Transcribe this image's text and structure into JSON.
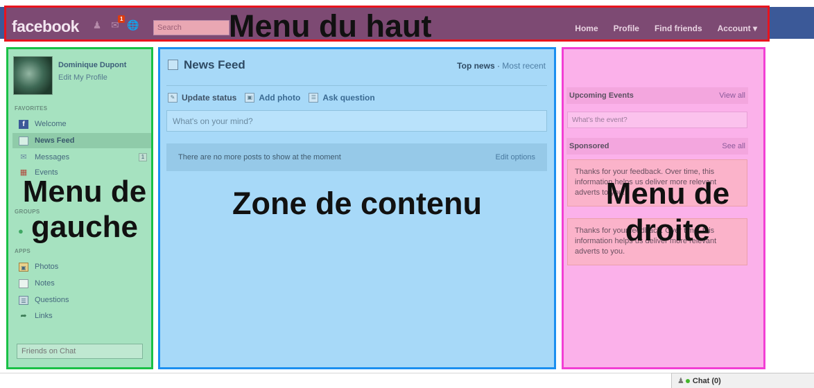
{
  "topbar": {
    "logo": "facebook",
    "notification_count": "1",
    "search_placeholder": "Search",
    "nav": [
      "Home",
      "Profile",
      "Find friends",
      "Account ▾"
    ],
    "overlay_label": "Menu du haut"
  },
  "left": {
    "profile_name": "Dominique Dupont",
    "edit_profile": "Edit My Profile",
    "favorites_header": "FAVORITES",
    "favorites": [
      {
        "label": "Welcome",
        "icon": "facebook-icon"
      },
      {
        "label": "News Feed",
        "icon": "news-feed-icon"
      },
      {
        "label": "Messages",
        "icon": "messages-icon",
        "count": "1"
      },
      {
        "label": "Events",
        "icon": "events-icon"
      }
    ],
    "groups_header": "GROUPS",
    "apps_header": "APPS",
    "apps": [
      {
        "label": "Photos",
        "icon": "photos-icon"
      },
      {
        "label": "Notes",
        "icon": "notes-icon"
      },
      {
        "label": "Questions",
        "icon": "questions-icon"
      },
      {
        "label": "Links",
        "icon": "links-icon"
      }
    ],
    "chat_search_placeholder": "Friends on Chat",
    "overlay_label": "Menu de gauche"
  },
  "center": {
    "title": "News Feed",
    "filter_top": "Top news",
    "filter_sep": " · ",
    "filter_recent": "Most recent",
    "tabs": [
      "Update status",
      "Add photo",
      "Ask question"
    ],
    "composer_placeholder": "What's on your mind?",
    "no_posts": "There are no more posts to show at the moment",
    "edit_options": "Edit options",
    "overlay_label": "Zone de contenu"
  },
  "right": {
    "events_header": "Upcoming Events",
    "events_view_all": "View all",
    "event_placeholder": "What's the event?",
    "sponsored_header": "Sponsored",
    "sponsored_see_all": "See all",
    "ad1": "Thanks for your feedback. Over time, this information helps us deliver more relevant adverts to you.",
    "ad2": "Thanks for your feedback. Over time, this information helps us deliver more relevant adverts to you.",
    "overlay_label": "Menu de droite"
  },
  "chat": {
    "label": "Chat (0)"
  },
  "colors": {
    "top_overlay": "#7d4a73",
    "top_border": "#e8141e",
    "left_overlay": "#a6e2c0",
    "left_border": "#19c146",
    "center_overlay": "#a7d9f8",
    "center_border": "#1b8ff0",
    "right_overlay": "#fbb1ea",
    "right_border": "#f23fd4"
  }
}
